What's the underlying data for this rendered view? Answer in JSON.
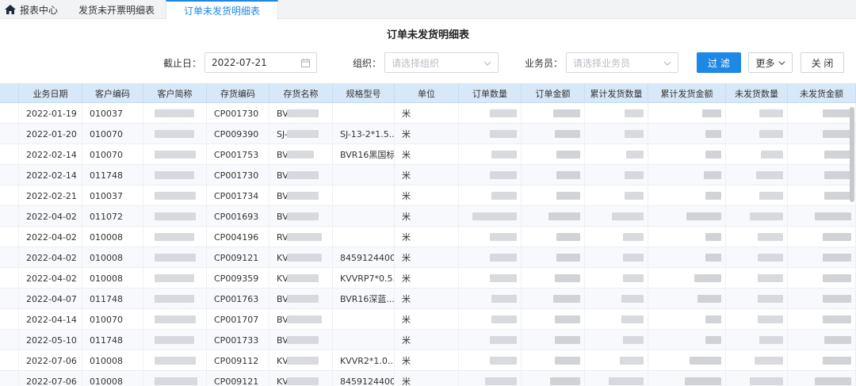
{
  "tabs": [
    {
      "label": "报表中心",
      "icon": "home-icon",
      "active": false
    },
    {
      "label": "发货未开票明细表",
      "active": false
    },
    {
      "label": "订单未发货明细表",
      "active": true
    }
  ],
  "title": "订单未发货明细表",
  "filters": {
    "date_label": "截止日：",
    "date_value": "2022-07-21",
    "org_label": "组织：",
    "org_placeholder": "请选择组织",
    "sales_label": "业务员：",
    "sales_placeholder": "请选择业务员"
  },
  "buttons": {
    "filter": "过 滤",
    "more": "更多",
    "close": "关 闭"
  },
  "colors": {
    "accent": "#1e88e5",
    "header_bg": "#d7e8f8"
  },
  "table": {
    "columns": [
      "业务日期",
      "客户编码",
      "客户简称",
      "存货编码",
      "存货名称",
      "规格型号",
      "单位",
      "订单数量",
      "订单金额",
      "累计发货数量",
      "累计发货金额",
      "未发货数量",
      "未发货金额"
    ],
    "rows": [
      {
        "date": "2022-01-19",
        "cust": "010037",
        "inv": "CP001730",
        "name": "BV",
        "spec": "",
        "unit": "米"
      },
      {
        "date": "2022-01-20",
        "cust": "010070",
        "inv": "CP009390",
        "name": "SJ-",
        "spec": "SJ-13-2*1.5...",
        "unit": "米"
      },
      {
        "date": "2022-02-14",
        "cust": "010070",
        "inv": "CP001753",
        "name": "BV",
        "spec": "BVR16黑国标",
        "unit": "米"
      },
      {
        "date": "2022-02-14",
        "cust": "011748",
        "inv": "CP001730",
        "name": "BV",
        "spec": "",
        "unit": "米"
      },
      {
        "date": "2022-02-21",
        "cust": "010037",
        "inv": "CP001734",
        "name": "BV",
        "spec": "",
        "unit": "米"
      },
      {
        "date": "2022-04-02",
        "cust": "011072",
        "inv": "CP001693",
        "name": "BV",
        "spec": "",
        "unit": "米"
      },
      {
        "date": "2022-04-02",
        "cust": "010008",
        "inv": "CP004196",
        "name": "RV",
        "spec": "",
        "unit": "米"
      },
      {
        "date": "2022-04-02",
        "cust": "010008",
        "inv": "CP009121",
        "name": "KV",
        "spec": "8459124400",
        "unit": "米"
      },
      {
        "date": "2022-04-02",
        "cust": "010008",
        "inv": "CP009359",
        "name": "KV",
        "spec": "KVVRP7*0.5...",
        "unit": "米"
      },
      {
        "date": "2022-04-07",
        "cust": "011748",
        "inv": "CP001763",
        "name": "BV",
        "spec": "BVR16深蓝...",
        "unit": "米"
      },
      {
        "date": "2022-04-14",
        "cust": "010070",
        "inv": "CP001707",
        "name": "BV",
        "spec": "",
        "unit": "米"
      },
      {
        "date": "2022-05-10",
        "cust": "011748",
        "inv": "CP001733",
        "name": "BV",
        "spec": "",
        "unit": "米"
      },
      {
        "date": "2022-07-06",
        "cust": "010008",
        "inv": "CP009112",
        "name": "KV",
        "spec": "KVVR2*1.0...",
        "unit": "米"
      },
      {
        "date": "2022-07-06",
        "cust": "010008",
        "inv": "CP009121",
        "name": "KV",
        "spec": "8459124400",
        "unit": "米"
      }
    ]
  }
}
